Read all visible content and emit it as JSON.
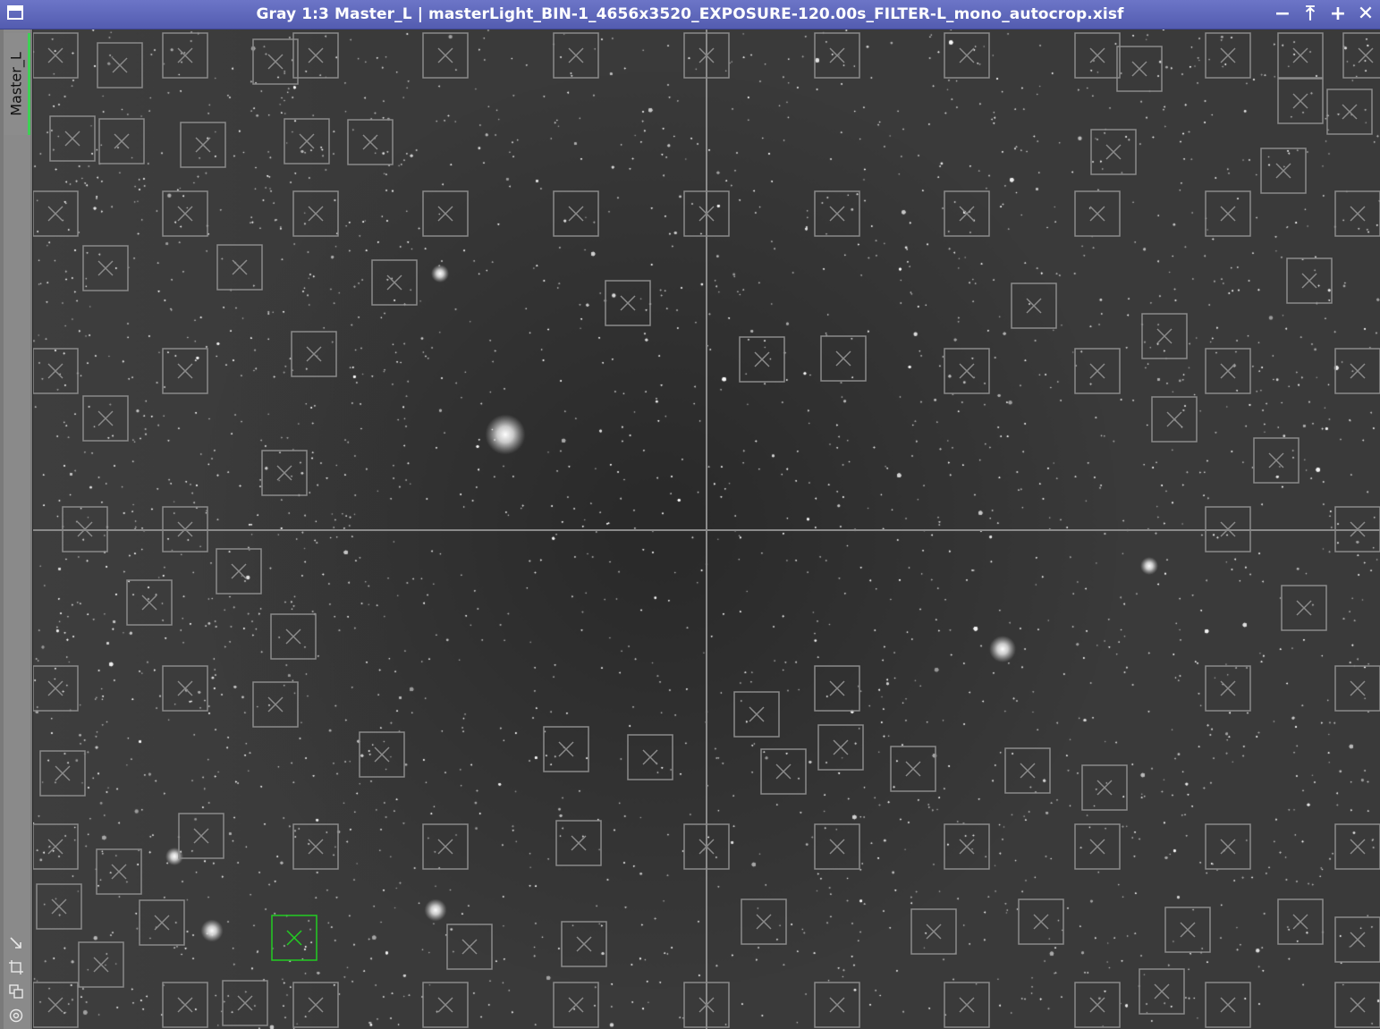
{
  "window": {
    "title": "Gray 1:3 Master_L | masterLight_BIN-1_4656x3520_EXPOSURE-120.00s_FILTER-L_mono_autocrop.xisf",
    "buttons": {
      "minimize": "−",
      "shade": "⤒",
      "maximize": "+",
      "close": "✕"
    }
  },
  "sidebar": {
    "view_tab_label": "Master_L",
    "tools": [
      {
        "name": "zoom-to-fit-icon"
      },
      {
        "name": "fit-view-icon"
      },
      {
        "name": "clone-view-icon"
      },
      {
        "name": "target-icon"
      }
    ]
  },
  "image": {
    "zoom": "1:3",
    "mode": "Gray",
    "selected_sample_color": "#22cc22",
    "sample_box_color": "#8a8a8a",
    "crosshair_color": "#8a8a8a"
  }
}
